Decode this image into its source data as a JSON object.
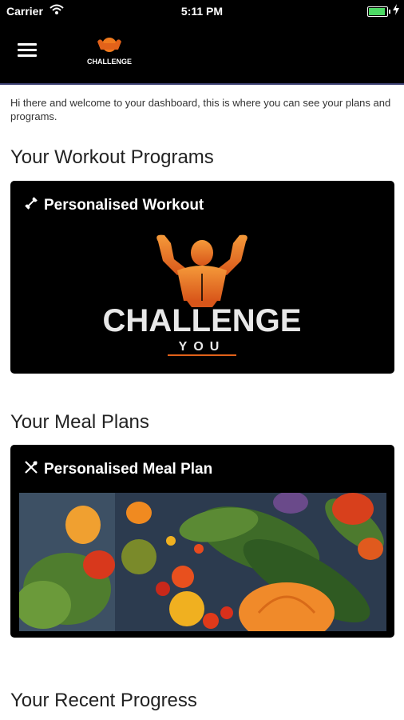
{
  "status_bar": {
    "carrier": "Carrier",
    "time": "5:11 PM"
  },
  "nav": {
    "menu_icon": "hamburger-icon",
    "logo_icon": "challenge-you-logo"
  },
  "intro_text": "Hi there and welcome to your dashboard, this is where you can see your plans and programs.",
  "workout": {
    "section_title": "Your Workout Programs",
    "card_title": "Personalised Workout",
    "card_icon": "dumbbell-icon",
    "logo_word": "CHALLENGE",
    "logo_sub": "YOU"
  },
  "meal": {
    "section_title": "Your Meal Plans",
    "card_title": "Personalised Meal Plan",
    "card_icon": "utensils-icon"
  },
  "progress": {
    "section_title": "Your Recent Progress"
  },
  "colors": {
    "accent_orange": "#f07a1e",
    "nav_border": "#3b3f72",
    "battery_green": "#4cd964"
  }
}
